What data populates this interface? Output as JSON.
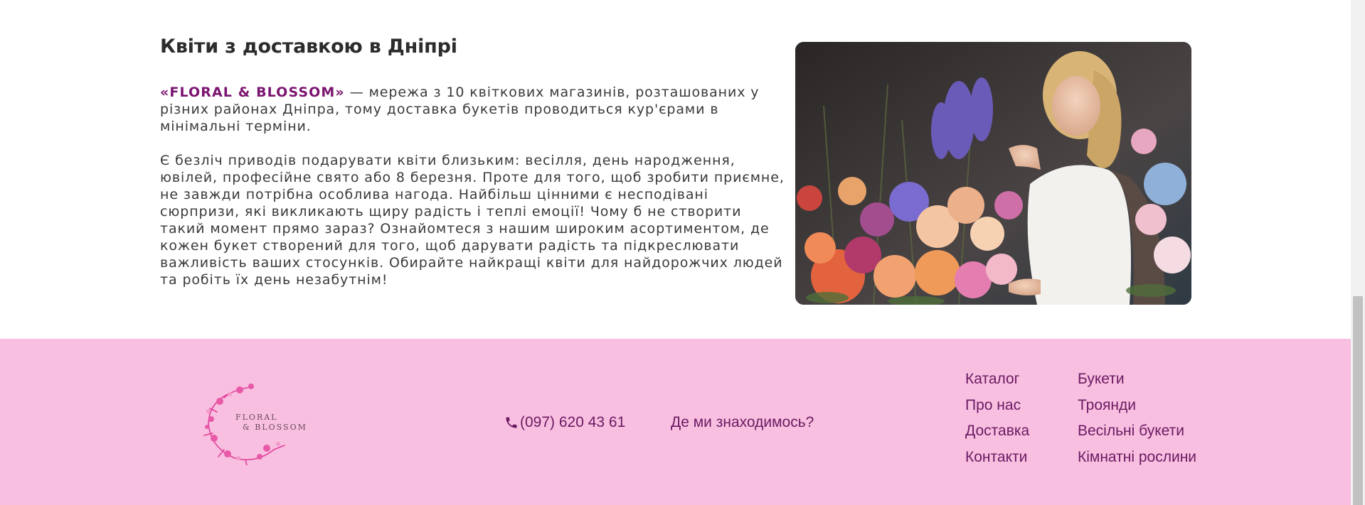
{
  "section": {
    "title": "Квіти з доставкою в Дніпрі",
    "brand": "«FLORAL & BLOSSOM»",
    "intro_rest": " — мережа з 10 квіткових магазинів, розташованих у різних районах Дніпра, тому доставка букетів проводиться кур'єрами в мінімальні терміни.",
    "paragraph2": "Є безліч приводів подарувати квіти близьким: весілля, день народження, ювілей, професійне свято або 8 березня. Проте для того, щоб зробити приємне, не завжди потрібна особлива нагода. Найбільш цінними є несподівані сюрпризи, які викликають щиру радість і теплі емоції! Чому б не створити такий момент прямо зараз? Ознайомтеся з нашим широким асортиментом, де кожен букет створений для того, щоб дарувати радість та підкреслювати важливість ваших стосунків. Обирайте найкращі квіти для найдорожчих людей та робіть їх день незабутнім!"
  },
  "footer": {
    "logo_line1": "FLORAL",
    "logo_line2": "& BLOSSOM",
    "phone": "(097) 620 43 61",
    "where_link": "Де ми знаходимось?",
    "nav_col1": [
      "Каталог",
      "Про нас",
      "Доставка",
      "Контакти"
    ],
    "nav_col2": [
      "Букети",
      "Троянди",
      "Весільні букети",
      "Кімнатні рослини"
    ]
  },
  "icons": {
    "phone": "phone-icon",
    "logo": "floral-wreath-logo"
  },
  "colors": {
    "brand_purple": "#7b1470",
    "footer_bg": "#f8bfe0",
    "link": "#6b1a62",
    "logo_pink": "#e0409a"
  }
}
